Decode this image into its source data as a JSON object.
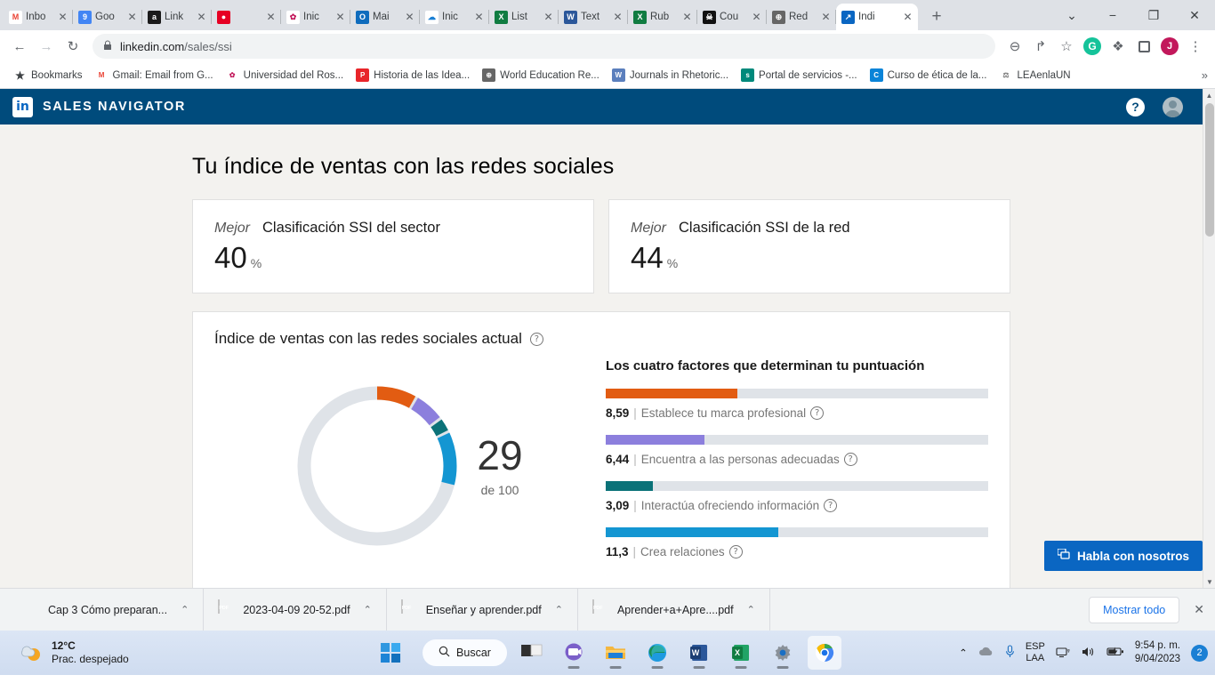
{
  "browser": {
    "tabs": [
      {
        "title": "Inbo",
        "fav": "M",
        "favbg": "#ffffff",
        "favcolor": "#ea4335",
        "active": false
      },
      {
        "title": "Goo",
        "fav": "9",
        "favbg": "#4285f4",
        "favcolor": "#ffffff",
        "active": false
      },
      {
        "title": "Link",
        "fav": "a",
        "favbg": "#1a1a1a",
        "favcolor": "#ffffff",
        "active": false
      },
      {
        "title": "",
        "fav": "●",
        "favbg": "#e60023",
        "favcolor": "#ffffff",
        "active": false
      },
      {
        "title": "Inic",
        "fav": "✿",
        "favbg": "#ffffff",
        "favcolor": "#c2185b",
        "active": false
      },
      {
        "title": "Mai",
        "fav": "O",
        "favbg": "#0f6cbd",
        "favcolor": "#ffffff",
        "active": false
      },
      {
        "title": "Inic",
        "fav": "☁",
        "favbg": "#ffffff",
        "favcolor": "#1a7fd4",
        "active": false
      },
      {
        "title": "List",
        "fav": "X",
        "favbg": "#107c41",
        "favcolor": "#ffffff",
        "active": false
      },
      {
        "title": "Text",
        "fav": "W",
        "favbg": "#2b579a",
        "favcolor": "#ffffff",
        "active": false
      },
      {
        "title": "Rub",
        "fav": "X",
        "favbg": "#107c41",
        "favcolor": "#ffffff",
        "active": false
      },
      {
        "title": "Cou",
        "fav": "☠",
        "favbg": "#111111",
        "favcolor": "#ffffff",
        "active": false
      },
      {
        "title": "Red",
        "fav": "⊕",
        "favbg": "#666666",
        "favcolor": "#ffffff",
        "active": false
      },
      {
        "title": "Índi",
        "fav": "↗",
        "favbg": "#0a66c2",
        "favcolor": "#ffffff",
        "active": true
      }
    ],
    "close_glyph": "✕",
    "newtab_glyph": "+",
    "window_controls": [
      "⌄",
      "−",
      "❐",
      "✕"
    ],
    "nav": {
      "back": "←",
      "forward": "→",
      "reload": "↻",
      "lock": "🔒",
      "url_host": "linkedin.com",
      "url_path": "/sales/ssi"
    },
    "toolbar_icons": [
      {
        "name": "zoom-icon",
        "glyph": "⊖"
      },
      {
        "name": "share-icon",
        "glyph": "↱"
      },
      {
        "name": "bookmark-star-icon",
        "glyph": "☆"
      },
      {
        "name": "grammarly-icon",
        "glyph": "G"
      },
      {
        "name": "extensions-puzzle-icon",
        "glyph": "❖"
      },
      {
        "name": "sidepanel-icon",
        "glyph": "◰"
      },
      {
        "name": "profile-avatar",
        "glyph": "J"
      },
      {
        "name": "chrome-menu-icon",
        "glyph": "⋮"
      }
    ],
    "bookmarks": [
      {
        "label": "Bookmarks",
        "ico": "★",
        "bg": "transparent",
        "color": "#3c4043"
      },
      {
        "label": "Gmail: Email from G...",
        "ico": "M",
        "bg": "#ffffff",
        "color": "#ea4335"
      },
      {
        "label": "Universidad del Ros...",
        "ico": "✿",
        "bg": "#ffffff",
        "color": "#c2185b"
      },
      {
        "label": "Historia de las Idea...",
        "ico": "P",
        "bg": "#e8252a",
        "color": "#ffffff"
      },
      {
        "label": "World Education Re...",
        "ico": "⊕",
        "bg": "#666666",
        "color": "#ffffff"
      },
      {
        "label": "Journals in Rhetoric...",
        "ico": "W",
        "bg": "#5b7fbd",
        "color": "#ffffff"
      },
      {
        "label": "Portal de servicios -...",
        "ico": "s",
        "bg": "#00897b",
        "color": "#ffffff"
      },
      {
        "label": "Curso de ética de la...",
        "ico": "C",
        "bg": "#0a84d8",
        "color": "#ffffff"
      },
      {
        "label": "LEAenlaUN",
        "ico": "⚖",
        "bg": "#ffffff",
        "color": "#777777"
      }
    ],
    "bookmarks_overflow": "»"
  },
  "app": {
    "brand": "SALES NAVIGATOR",
    "logo_text": "in",
    "help_glyph": "?",
    "header_bg": "#004b7c"
  },
  "main": {
    "page_title": "Tu índice de ventas con las redes sociales",
    "rank_cards": [
      {
        "badge": "Mejor",
        "label": "Clasificación SSI del sector",
        "value": "40",
        "unit": "%"
      },
      {
        "badge": "Mejor",
        "label": "Clasificación SSI de la red",
        "value": "44",
        "unit": "%"
      }
    ],
    "ssi_card": {
      "title": "Índice de ventas con las redes sociales actual",
      "help_glyph": "?",
      "score": "29",
      "score_sub": "de 100",
      "factors_title": "Los cuatro factores que determinan tu puntuación"
    },
    "chat_button": {
      "label": "Habla con nosotros",
      "icon": "chat-icon"
    }
  },
  "chart_data": {
    "type": "pie",
    "title": "Índice de ventas con las redes sociales actual",
    "total_label": "de 100",
    "total": 100,
    "score": 29,
    "track_color": "#dfe3e8",
    "categories": [
      "Establece tu marca profesional",
      "Encuentra a las personas adecuadas",
      "Interactúa ofreciendo información",
      "Crea relaciones"
    ],
    "values": [
      8.59,
      6.44,
      3.09,
      11.3
    ],
    "value_labels": [
      "8,59",
      "6,44",
      "3,09",
      "11,3"
    ],
    "colors": [
      "#e25c12",
      "#8c7fdd",
      "#0b7278",
      "#1496d2"
    ],
    "max_per_factor": 25,
    "bar_fill_pct": [
      34.4,
      25.8,
      12.4,
      45.2
    ],
    "legend_position": "right",
    "grid": false
  },
  "downloads": {
    "items": [
      {
        "name": "Cap 3 Cómo preparan...",
        "type": "ppt"
      },
      {
        "name": "2023-04-09 20-52.pdf",
        "type": "pdf"
      },
      {
        "name": "Enseñar y aprender.pdf",
        "type": "pdf"
      },
      {
        "name": "Aprender+a+Apre....pdf",
        "type": "pdf"
      }
    ],
    "chevron": "⌃",
    "show_all": "Mostrar todo",
    "close": "✕"
  },
  "taskbar": {
    "weather_temp": "12°C",
    "weather_desc": "Prac. despejado",
    "search_placeholder": "Buscar",
    "search_icon": "⚲",
    "apps": [
      {
        "name": "taskview-icon",
        "glyph": ""
      },
      {
        "name": "teams-icon",
        "glyph": ""
      },
      {
        "name": "file-explorer-icon",
        "glyph": ""
      },
      {
        "name": "edge-icon",
        "glyph": ""
      },
      {
        "name": "word-icon",
        "glyph": "W"
      },
      {
        "name": "excel-icon",
        "glyph": "X"
      },
      {
        "name": "settings-icon",
        "glyph": ""
      },
      {
        "name": "chrome-icon",
        "glyph": ""
      }
    ],
    "tray_chevron": "⌃",
    "lang_line1": "ESP",
    "lang_line2": "LAA",
    "time": "9:54 p. m.",
    "date": "9/04/2023",
    "badge": "2"
  }
}
